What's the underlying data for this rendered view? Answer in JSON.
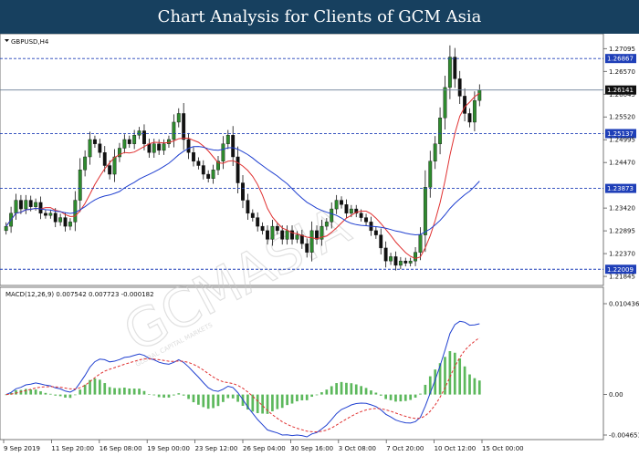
{
  "header": {
    "title": "Chart Analysis for Clients of GCM Asia"
  },
  "watermark": {
    "brand": "GCMASIA",
    "tagline": "GLOBAL CAPITAL MARKETS"
  },
  "colors": {
    "banner": "#17405f",
    "candle_up": "#2e8b2e",
    "candle_down": "#111111",
    "ma_fast": "#e03030",
    "ma_slow": "#2040d0",
    "level_line": "#1f3fb8",
    "macd_line": "#2040d0",
    "signal_line": "#e03030",
    "histogram": "#5cb85c"
  },
  "chart_data": [
    {
      "type": "candlestick",
      "title": "GBPUSD,H4",
      "x_labels": [
        "9 Sep 2019",
        "11 Sep 20:00",
        "16 Sep 08:00",
        "19 Sep 00:00",
        "23 Sep 12:00",
        "26 Sep 04:00",
        "30 Sep 16:00",
        "3 Oct 08:00",
        "7 Oct 20:00",
        "10 Oct 12:00",
        "15 Oct 00:00"
      ],
      "y_ticks": [
        "1.27095",
        "1.26570",
        "1.26045",
        "1.25520",
        "1.24995",
        "1.24470",
        "1.23420",
        "1.22895",
        "1.22370",
        "1.21845"
      ],
      "ylim": [
        1.2172,
        1.2727
      ],
      "levels": [
        "1.26867",
        "1.25137",
        "1.23873",
        "1.22009"
      ],
      "current_price": "1.26141",
      "closes": [
        1.23,
        1.233,
        1.236,
        1.234,
        1.236,
        1.2345,
        1.2355,
        1.233,
        1.2325,
        1.233,
        1.231,
        1.232,
        1.23,
        1.231,
        1.236,
        1.243,
        1.246,
        1.25,
        1.249,
        1.247,
        1.244,
        1.242,
        1.246,
        1.248,
        1.25,
        1.249,
        1.251,
        1.252,
        1.249,
        1.247,
        1.249,
        1.2475,
        1.249,
        1.25,
        1.254,
        1.256,
        1.25,
        1.247,
        1.245,
        1.244,
        1.242,
        1.241,
        1.243,
        1.245,
        1.249,
        1.251,
        1.246,
        1.24,
        1.236,
        1.233,
        1.232,
        1.23,
        1.229,
        1.227,
        1.23,
        1.229,
        1.227,
        1.229,
        1.227,
        1.228,
        1.226,
        1.224,
        1.229,
        1.227,
        1.23,
        1.231,
        1.234,
        1.236,
        1.235,
        1.233,
        1.234,
        1.233,
        1.232,
        1.231,
        1.229,
        1.228,
        1.225,
        1.222,
        1.223,
        1.221,
        1.222,
        1.2215,
        1.222,
        1.224,
        1.228,
        1.239,
        1.245,
        1.249,
        1.255,
        1.262,
        1.269,
        1.264,
        1.26,
        1.256,
        1.254,
        1.259,
        1.2614
      ],
      "series": [
        {
          "name": "MA fast"
        },
        {
          "name": "MA slow"
        }
      ]
    },
    {
      "type": "line",
      "title": "MACD(12,26,9) 0.007542 0.007723 -0.000182",
      "y_ticks": [
        "0.010436",
        "0.00",
        "-0.004651"
      ],
      "ylim": [
        -0.004651,
        0.010436
      ],
      "histogram_color": "#5cb85c"
    }
  ]
}
